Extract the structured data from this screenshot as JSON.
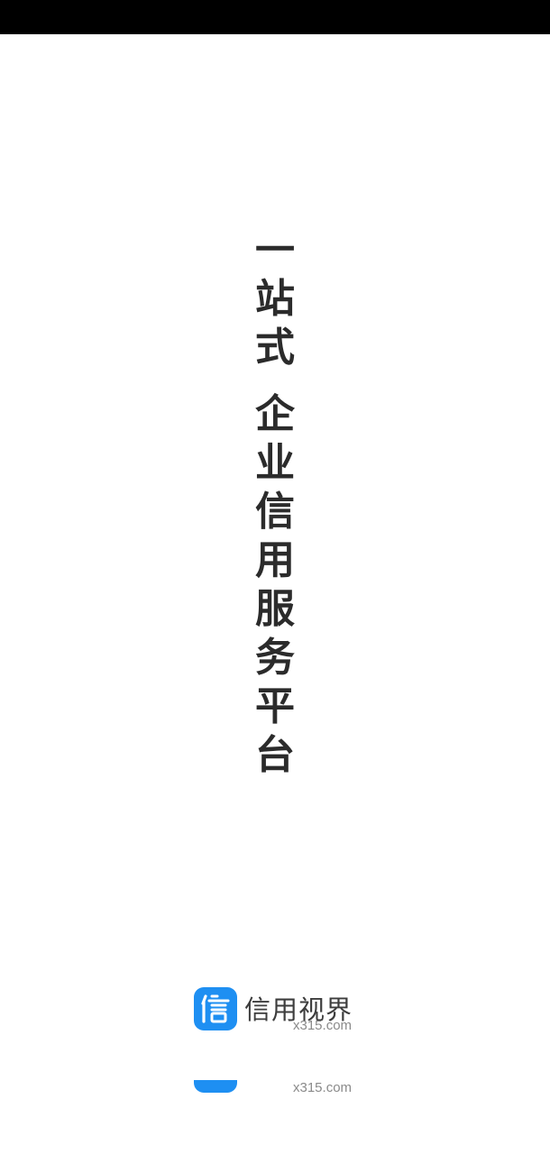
{
  "slogan": {
    "line1": [
      "一",
      "站",
      "式"
    ],
    "line2": [
      "企",
      "业",
      "信",
      "用",
      "服",
      "务",
      "平",
      "台"
    ]
  },
  "brand": {
    "logo_icon": "xin-character-logo-icon",
    "logo_char": "信",
    "name": "信用视界",
    "domain": "x315.com",
    "accent_color": "#1e8ff2"
  },
  "footer_duplicate": {
    "domain": "x315.com"
  }
}
